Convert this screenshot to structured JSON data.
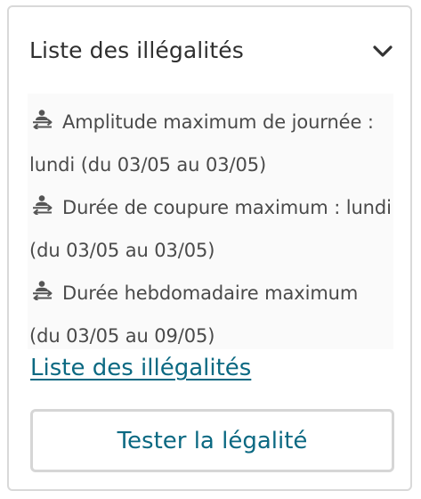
{
  "panel": {
    "title": "Liste des illégalités",
    "expand_icon": "chevron-down-icon",
    "items": [
      {
        "icon": "people-swap-icon",
        "text": "Amplitude maximum de journée : lundi (du 03/05 au 03/05)"
      },
      {
        "icon": "people-swap-icon",
        "text": "Durée de coupure maximum : lundi (du 03/05 au 03/05)"
      },
      {
        "icon": "people-swap-icon",
        "text": "Durée hebdomadaire maximum (du 03/05 au 09/05)"
      }
    ],
    "link_label": "Liste des illégalités",
    "button_label": "Tester la légalité"
  },
  "colors": {
    "accent": "#0b6982",
    "text": "#2f2f2f",
    "item_text": "#4a4a4a",
    "border": "#d9d9d9",
    "list_background": "#fafafa"
  }
}
